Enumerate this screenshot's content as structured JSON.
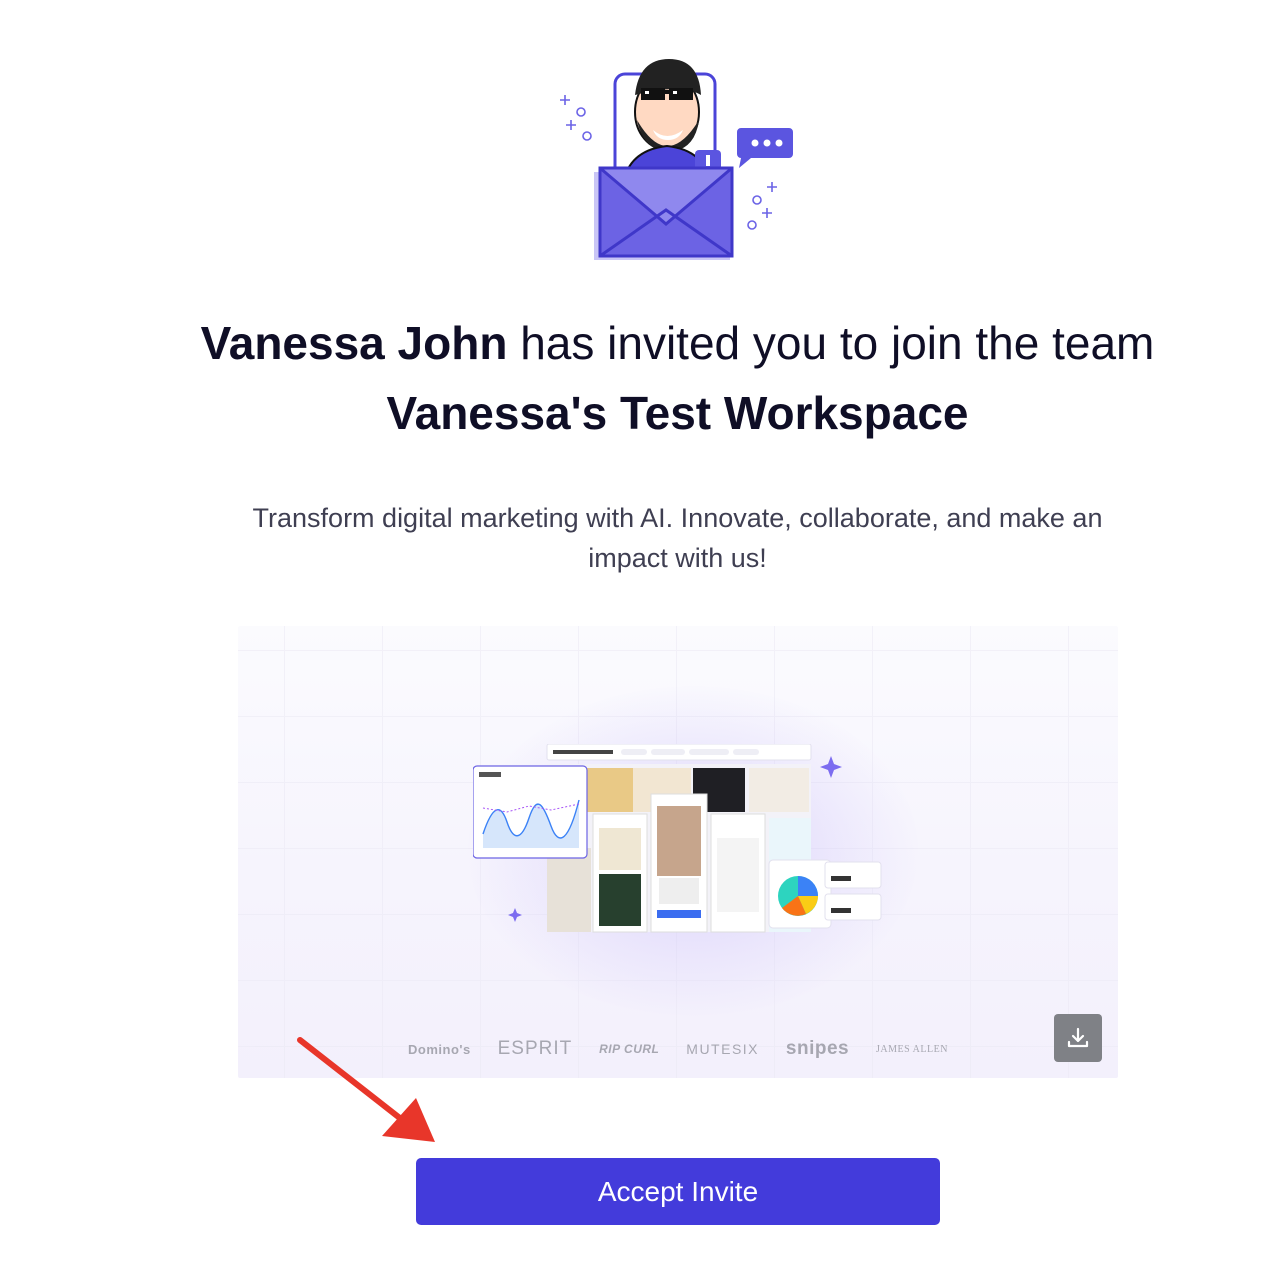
{
  "invite": {
    "inviter_name": "Vanessa John",
    "headline_middle": " has invited you to join the team ",
    "workspace_name": "Vanessa's Test Workspace",
    "subtext": "Transform digital marketing with AI. Innovate, collaborate, and make an impact with us!",
    "accept_label": "Accept Invite"
  },
  "preview": {
    "logos": [
      "Domino's",
      "ESPRIT",
      "RIP CURL",
      "MUTESIX",
      "snipes",
      "JAMES ALLEN"
    ],
    "download_icon": "download-icon"
  },
  "colors": {
    "accent": "#433bdb",
    "illustration": "#5b55e0",
    "arrow": "#e8362a"
  }
}
